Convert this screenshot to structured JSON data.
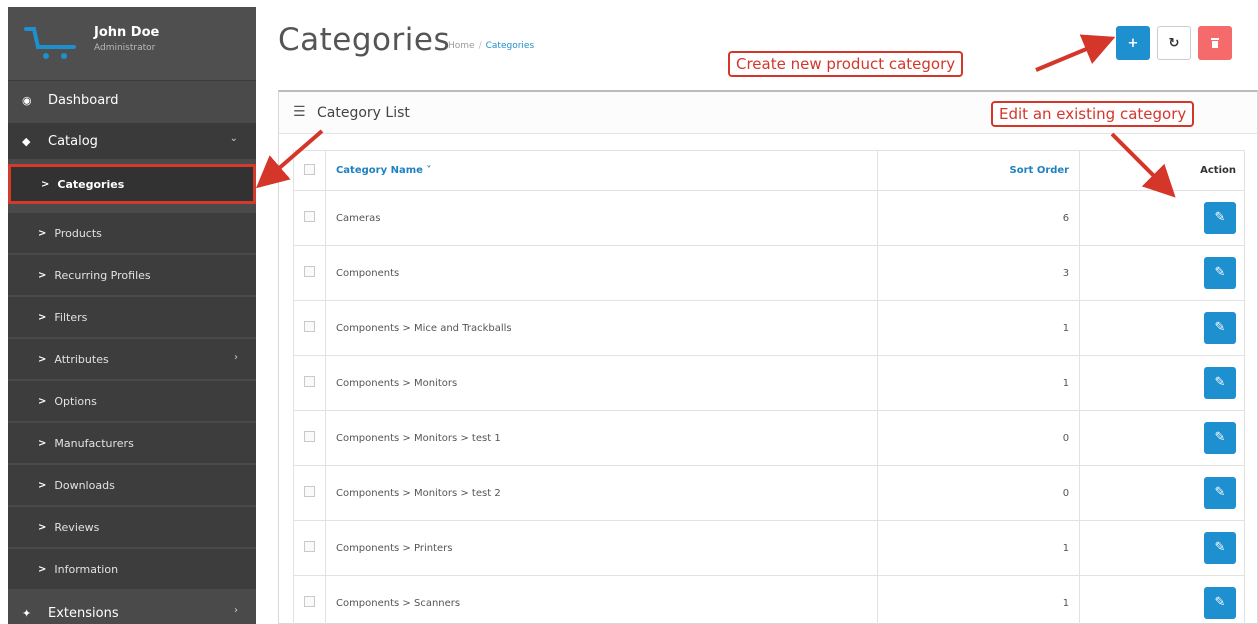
{
  "sidebar": {
    "user_name": "John Doe",
    "user_role": "Administrator",
    "dashboard_label": "Dashboard",
    "catalog_label": "Catalog",
    "extensions_label": "Extensions",
    "catalog_items": [
      {
        "label": "Categories"
      },
      {
        "label": "Products"
      },
      {
        "label": "Recurring Profiles"
      },
      {
        "label": "Filters"
      },
      {
        "label": "Attributes"
      },
      {
        "label": "Options"
      },
      {
        "label": "Manufacturers"
      },
      {
        "label": "Downloads"
      },
      {
        "label": "Reviews"
      },
      {
        "label": "Information"
      }
    ]
  },
  "header": {
    "title": "Categories",
    "breadcrumb": [
      "Home",
      "Categories"
    ],
    "add_icon": "plus-icon",
    "refresh_icon": "refresh-icon",
    "delete_icon": "trash-icon"
  },
  "panel": {
    "title": "Category List",
    "columns": {
      "name": "Category Name",
      "sort_order": "Sort Order",
      "action": "Action"
    },
    "rows": [
      {
        "name": "Cameras",
        "sort_order": "6"
      },
      {
        "name": "Components",
        "sort_order": "3"
      },
      {
        "name": "Components > Mice and Trackballs",
        "sort_order": "1"
      },
      {
        "name": "Components > Monitors",
        "sort_order": "1"
      },
      {
        "name": "Components > Monitors > test 1",
        "sort_order": "0"
      },
      {
        "name": "Components > Monitors > test 2",
        "sort_order": "0"
      },
      {
        "name": "Components > Printers",
        "sort_order": "1"
      },
      {
        "name": "Components > Scanners",
        "sort_order": "1"
      }
    ]
  },
  "annotations": {
    "create": "Create new product category",
    "edit": "Edit an existing category"
  },
  "colors": {
    "accent": "#1e8fcf",
    "danger": "#f56b6b",
    "annotation": "#d4362a",
    "sidebar_bg": "#4a4a4a"
  }
}
